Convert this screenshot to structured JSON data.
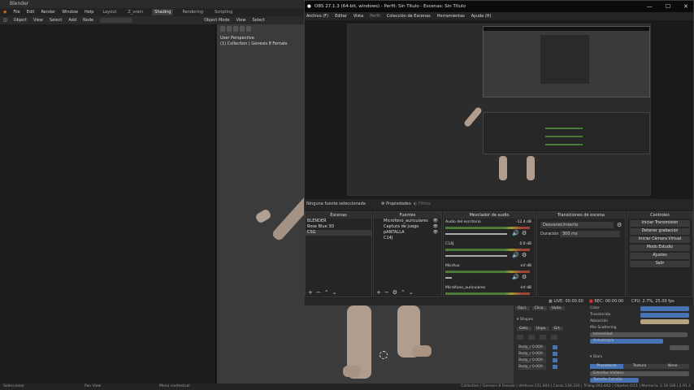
{
  "blender": {
    "title": "Blender",
    "menu": [
      "File",
      "Edit",
      "Render",
      "Window",
      "Help"
    ],
    "workspaces": [
      "Layout",
      "Z_vrem",
      "Shading",
      "Rendering",
      "Scripting"
    ],
    "active_workspace": "Shading",
    "header2": [
      "Object",
      "View",
      "Select",
      "Add",
      "Node"
    ],
    "viewport_mode": "Object Mode",
    "viewport_menu": [
      "View",
      "Select"
    ],
    "viewport_info_line1": "User Perspective",
    "viewport_info_line2": "(1) Collection | Genesis 8 Female",
    "status_left": "Seleccionar",
    "status_mid": "Pan View",
    "status_mid2": "Menú contextual",
    "status_right": "Collection | Genesis 8 Female | Vértices:131,604 | Caras:130,320 | Triáng:261,642 | Objetos:0/11 | Memoria: 2.18 GiB | 2.91.2",
    "props": {
      "buttons": [
        "Opci.",
        "Clica.",
        "Vuda."
      ],
      "shapes_header": "Shapes",
      "shape_buttons": [
        "Gets.",
        "Unps.",
        "Grt."
      ],
      "shape_rows": [
        "Body_r  0.000",
        "Body_r  0.000",
        "Body_r  0.000",
        "Body_r  0.000"
      ],
      "right_rows": [
        "Color",
        "Translúcido",
        "Absorción",
        "Mie Scattering",
        "Intensidad",
        "Anisotropía",
        "Anisotropía"
      ],
      "stars_header": "Stars",
      "stars_buttons": [
        "Procedural",
        "Textura",
        "None"
      ],
      "stars_rows": [
        "Estrellas Visibles",
        "Tamaño Estrella"
      ]
    }
  },
  "obs": {
    "title": "OBS 27.1.3 (64-bit, windows) - Perfil: Sin Título - Escenas: Sin Título",
    "window_controls": [
      "—",
      "☐",
      "✕"
    ],
    "menu": [
      "Archivo (F)",
      "Editar",
      "Vista",
      "Perfil",
      "Colección de Escenas",
      "Herramientas",
      "Ayuda (H)"
    ],
    "no_source": "Ninguna fuente seleccionada",
    "properties_btn": "Propiedades",
    "filters_btn": "Filtros",
    "docks": {
      "scenes": {
        "title": "Escenas",
        "items": [
          "BLENDER",
          "Rose Blue 3D",
          "CSG"
        ],
        "selected": 2
      },
      "sources": {
        "title": "Fuentes",
        "items": [
          "Micrófono_auriculares",
          "Captura de juego",
          "pANTALLA",
          "C14J"
        ]
      },
      "mixer": {
        "title": "Mezclador de audio",
        "channels": [
          {
            "name": "Audio del escritorio",
            "db": "-12.4 dB"
          },
          {
            "name": "C14J",
            "db": "0.0 dB"
          },
          {
            "name": "Mic/Aux",
            "db": "-inf dB"
          },
          {
            "name": "Micrófono_auriculares",
            "db": "-inf dB"
          }
        ]
      },
      "transitions": {
        "title": "Transiciones de escena",
        "selected": "Desvanecimiento",
        "duration_label": "Duración",
        "duration_value": "300 ms"
      },
      "controls": {
        "title": "Controles",
        "buttons": [
          "Iniciar Transmisión",
          "Detener grabación",
          "Iniciar Cámara Virtual",
          "Modo Estudio",
          "Ajustes",
          "Salir"
        ]
      }
    },
    "status": {
      "live": "LIVE: 00:00:00",
      "rec": "REC: 00:00:00",
      "cpu": "CPU: 2.7%, 25.00 fps"
    }
  }
}
